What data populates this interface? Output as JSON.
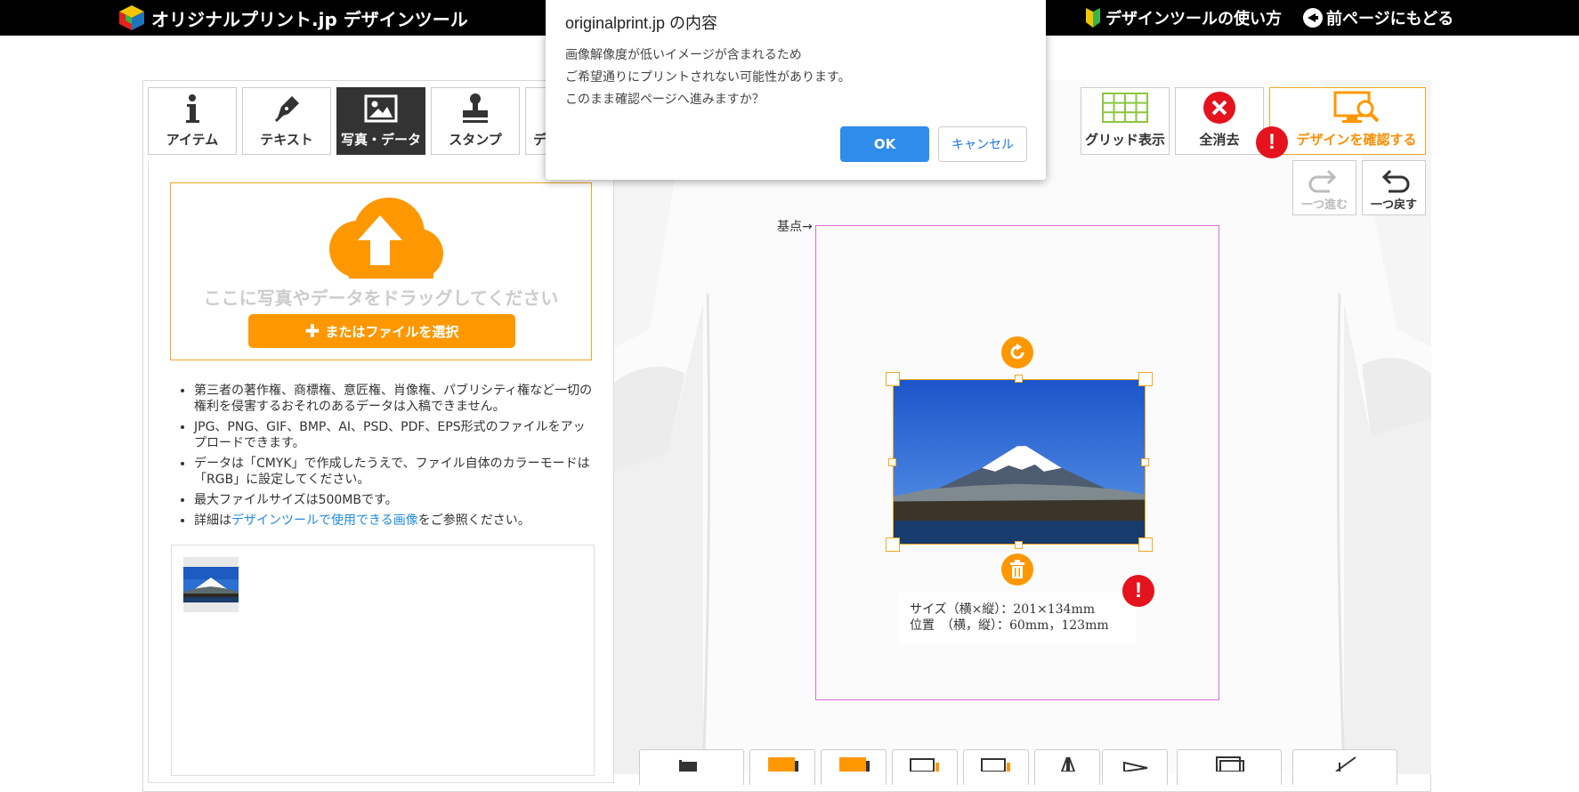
{
  "topbar": {
    "brand": "オリジナルプリント.jp デザインツール",
    "links": [
      {
        "label": "デザインツールの使い方",
        "icon": "beginner-leaf-icon"
      },
      {
        "label": "前ページにもどる",
        "icon": "back-arrow-icon"
      }
    ]
  },
  "tabs": [
    {
      "label": "アイテム",
      "icon": "info-icon",
      "active": false
    },
    {
      "label": "テキスト",
      "icon": "pen-icon",
      "active": false
    },
    {
      "label": "写真・データ",
      "icon": "image-icon",
      "active": true
    },
    {
      "label": "スタンプ",
      "icon": "stamp-icon",
      "active": false
    },
    {
      "label": "デ",
      "icon": "design-icon",
      "active": false
    }
  ],
  "upload": {
    "drop_text": "ここに写真やデータをドラッグしてください",
    "select_label": "またはファイルを選択"
  },
  "rules": [
    {
      "text": "第三者の著作権、商標権、意匠権、肖像権、パブリシティ権など一切の権利を侵害するおそれのあるデータは入稿できません。"
    },
    {
      "text": "JPG、PNG、GIF、BMP、AI、PSD、PDF、EPS形式のファイルをアップロードできます。"
    },
    {
      "text": "データは「CMYK」で作成したうえで、ファイル自体のカラーモードは「RGB」に設定してください。"
    },
    {
      "text": "最大ファイルサイズは500MBです。"
    },
    {
      "prefix": "詳細は",
      "link": "デザインツールで使用できる画像",
      "suffix": "をご参照ください。"
    }
  ],
  "canvas": {
    "origin_label": "基点→",
    "size_line": "サイズ（横×縦）：201×134mm",
    "position_line": "位置　（横，縦）：60mm，123mm",
    "warning_mark": "!"
  },
  "right_tools": {
    "grid_label": "グリッド表示",
    "clear_label": "全消去",
    "confirm_label": "デザインを確認する",
    "redo_label": "一つ進む",
    "undo_label": "一つ戻す"
  },
  "dialog": {
    "title": "originalprint.jp の内容",
    "lines": [
      "画像解像度が低いイメージが含まれるため",
      "ご希望通りにプリントされない可能性があります。",
      "このまま確認ページへ進みますか？"
    ],
    "ok_label": "OK",
    "cancel_label": "キャンセル"
  },
  "colors": {
    "accent": "#ff9800",
    "warning": "#e5131d",
    "print_area_border": "#e36bd8",
    "ok_button": "#2f8cea"
  }
}
